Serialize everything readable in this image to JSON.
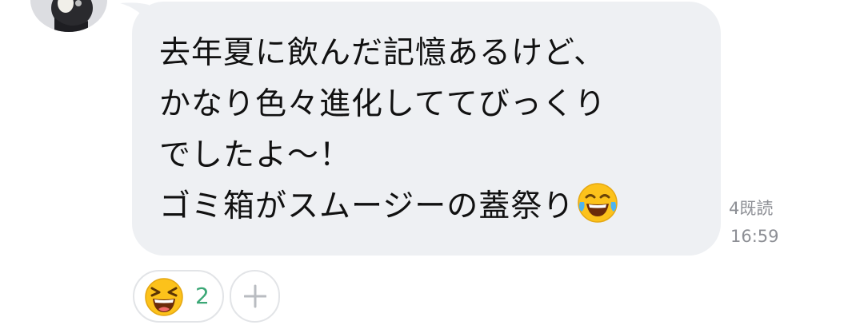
{
  "message": {
    "lines": [
      "去年夏に飲んだ記憶あるけど、",
      "かなり色々進化しててびっくり",
      "でしたよ〜！",
      "ゴミ箱がスムージーの蓋祭り"
    ],
    "trailing_emoji": "face-with-tears-of-joy",
    "read_status": "4既読",
    "time": "16:59"
  },
  "reactions": [
    {
      "emoji": "grinning-squinting-face",
      "count": "2"
    }
  ],
  "add_reaction": {
    "icon": "plus-icon"
  },
  "colors": {
    "bubble": "#eef0f3",
    "text": "#111111",
    "meta": "#8d8f95",
    "reaction_count": "#3ba776",
    "chip_border": "#e2e4e7"
  }
}
